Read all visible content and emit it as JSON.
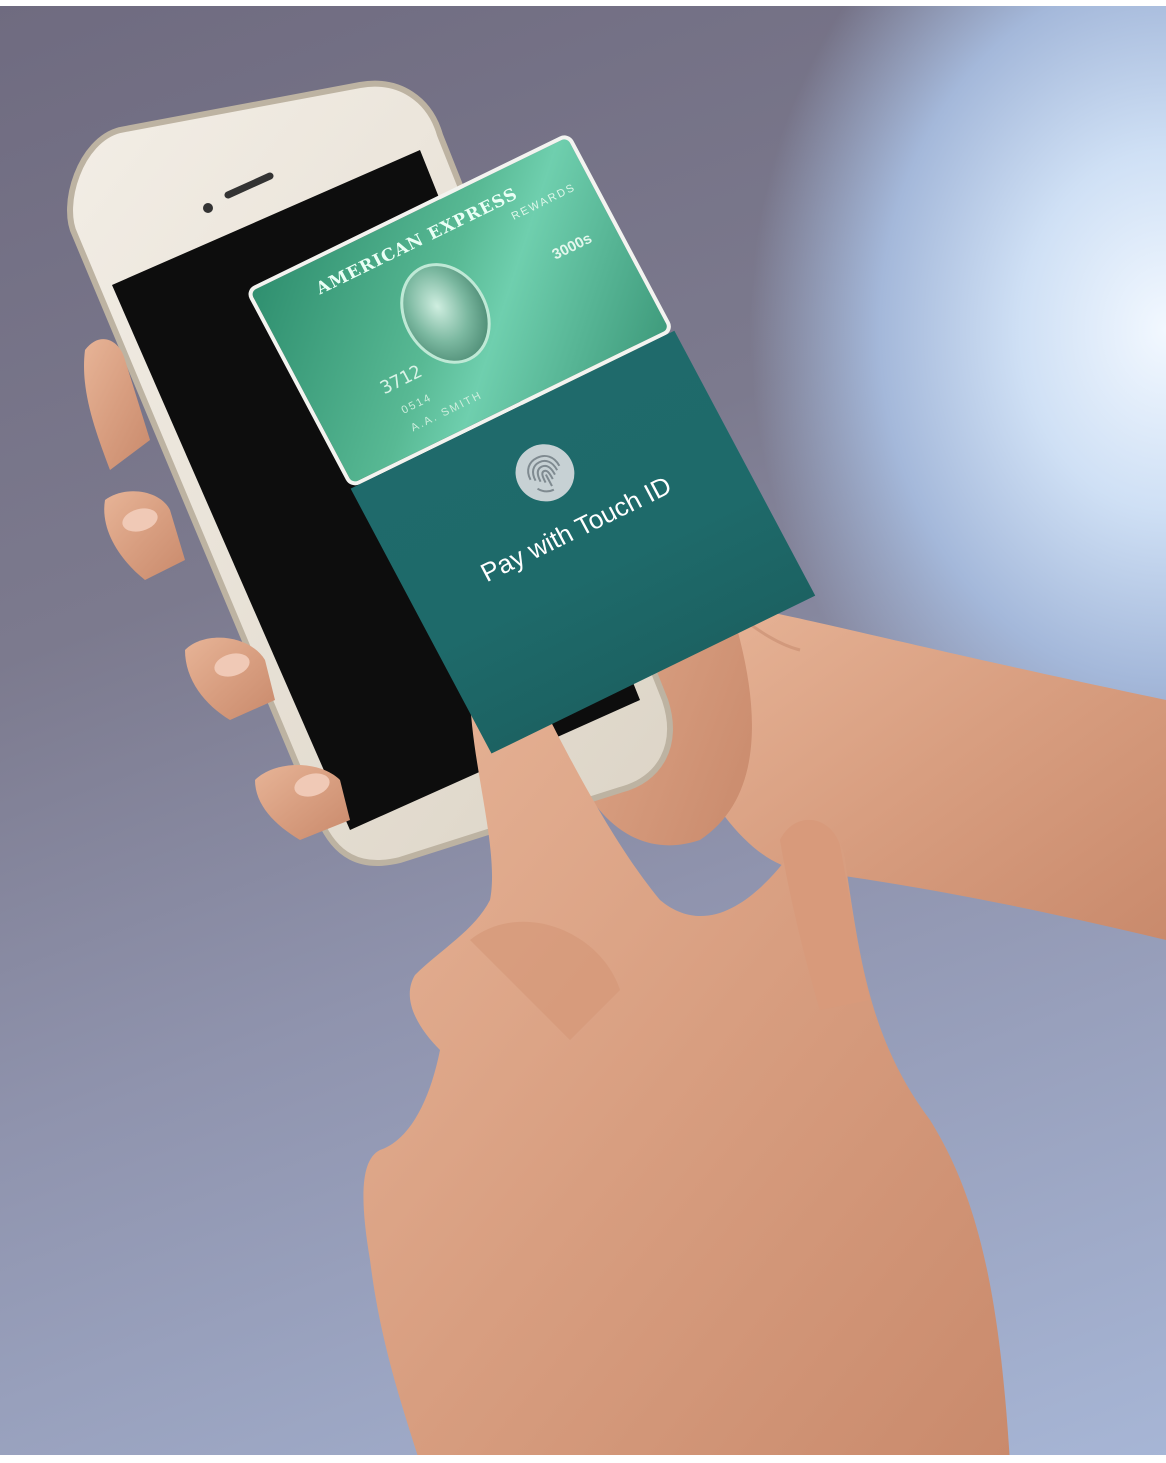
{
  "card": {
    "brand": "AMERICAN EXPRESS",
    "tier": "REWARDS",
    "number_fragment": "3712",
    "small_line_1": "0514",
    "small_line_2": "A.A. SMITH",
    "side_text": "3000s"
  },
  "prompt": {
    "label": "Pay with Touch ID"
  },
  "colors": {
    "card_green": "#58b994",
    "panel_teal": "#1f6a6b",
    "phone_body": "#ece6da"
  },
  "icons": {
    "fingerprint": "fingerprint-icon"
  }
}
